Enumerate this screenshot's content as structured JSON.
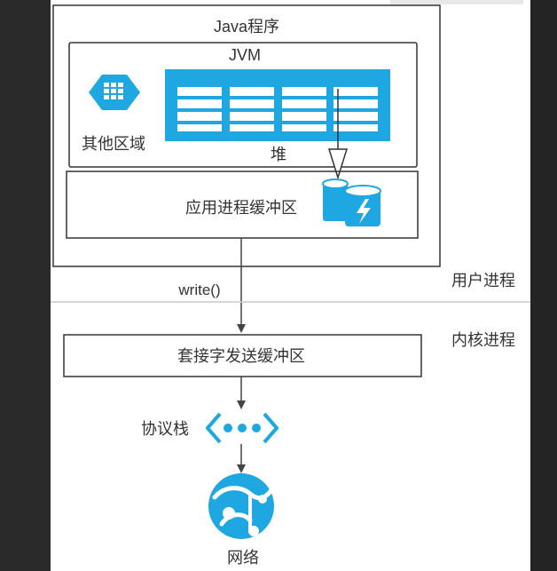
{
  "diagram": {
    "java_program_label": "Java程序",
    "jvm_label": "JVM",
    "other_region_label": "其他区域",
    "heap_label": "堆",
    "app_buffer_label": "应用进程缓冲区",
    "write_call_label": "write()",
    "user_process_label": "用户进程",
    "kernel_process_label": "内核进程",
    "socket_buffer_label": "套接字发送缓冲区",
    "protocol_stack_label": "协议栈",
    "network_label": "网络"
  },
  "colors": {
    "accent": "#1ea7e1",
    "line": "#333333",
    "divider": "#c8c8c8"
  },
  "icons": {
    "other_region": "hexagon-grid-icon",
    "heap": "table-grid-icon",
    "cache": "database-flash-icon",
    "protocol_stack": "ellipsis-chevrons-icon",
    "network": "globe-icon"
  }
}
